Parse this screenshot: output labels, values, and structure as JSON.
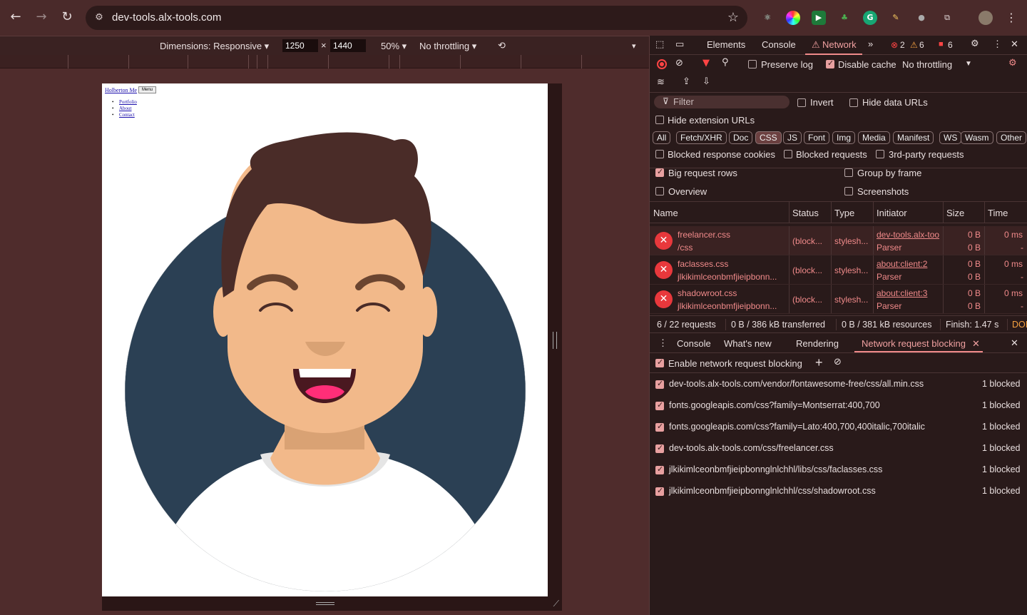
{
  "browser": {
    "url": "dev-tools.alx-tools.com",
    "back_icon": "←",
    "forward_icon": "→",
    "reload_icon": "↻",
    "site_info_icon": "⚙",
    "star_icon": "☆",
    "menu_icon": "⋮"
  },
  "device_toolbar": {
    "dimensions_label": "Dimensions: Responsive ▾",
    "width": "1250",
    "times": "×",
    "height": "1440",
    "zoom": "50% ▾",
    "throttling": "No throttling ▾",
    "more_icon": "▾"
  },
  "site": {
    "brand": "Holberton Me",
    "menu_button": "Menu",
    "nav": [
      "Portfolio",
      "About",
      "Contact"
    ]
  },
  "devtools": {
    "tabs": [
      "Elements",
      "Console",
      "Network"
    ],
    "network_warning_icon": "⚠",
    "active_tab": "Network",
    "more_tabs": "»",
    "errors_count": "2",
    "warnings_count": "6",
    "issues_count": "6",
    "toolbar": {
      "preserve_log": "Preserve log",
      "disable_cache": "Disable cache",
      "throttling": "No throttling"
    },
    "filter": {
      "placeholder": "Filter",
      "invert": "Invert",
      "hide_data_urls": "Hide data URLs",
      "hide_extension_urls": "Hide extension URLs"
    },
    "type_filters": [
      "All",
      "Fetch/XHR",
      "Doc",
      "CSS",
      "JS",
      "Font",
      "Img",
      "Media",
      "Manifest",
      "WS",
      "Wasm",
      "Other"
    ],
    "active_type": "CSS",
    "options": {
      "blocked_response_cookies": "Blocked response cookies",
      "blocked_requests": "Blocked requests",
      "third_party": "3rd-party requests",
      "big_request_rows": "Big request rows",
      "group_by_frame": "Group by frame",
      "overview": "Overview",
      "screenshots": "Screenshots"
    },
    "table": {
      "headers": [
        "Name",
        "Status",
        "Type",
        "Initiator",
        "Size",
        "Time"
      ],
      "rows": [
        {
          "name": "freelancer.css",
          "path": "/css",
          "status": "(block...",
          "type": "stylesh...",
          "initiator": "dev-tools.alx-too",
          "initiator_sub": "Parser",
          "size1": "0 B",
          "size2": "0 B",
          "time1": "0 ms",
          "time2": "-"
        },
        {
          "name": "faclasses.css",
          "path": "jlkikimlceonbmfjieipbonn...",
          "status": "(block...",
          "type": "stylesh...",
          "initiator": "about:client:2",
          "initiator_sub": "Parser",
          "size1": "0 B",
          "size2": "0 B",
          "time1": "0 ms",
          "time2": "-"
        },
        {
          "name": "shadowroot.css",
          "path": "jlkikimlceonbmfjieipbonn...",
          "status": "(block...",
          "type": "stylesh...",
          "initiator": "about:client:3",
          "initiator_sub": "Parser",
          "size1": "0 B",
          "size2": "0 B",
          "time1": "0 ms",
          "time2": "-"
        }
      ]
    },
    "summary": {
      "requests": "6 / 22 requests",
      "transferred": "0 B / 386 kB transferred",
      "resources": "0 B / 381 kB resources",
      "finish": "Finish: 1.47 s",
      "dom": "DOI"
    },
    "drawer": {
      "tabs": [
        "Console",
        "What's new",
        "Rendering",
        "Network request blocking"
      ],
      "active": "Network request blocking",
      "enable_label": "Enable network request blocking",
      "patterns": [
        {
          "url": "dev-tools.alx-tools.com/vendor/fontawesome-free/css/all.min.css",
          "count": "1 blocked"
        },
        {
          "url": "fonts.googleapis.com/css?family=Montserrat:400,700",
          "count": "1 blocked"
        },
        {
          "url": "fonts.googleapis.com/css?family=Lato:400,700,400italic,700italic",
          "count": "1 blocked"
        },
        {
          "url": "dev-tools.alx-tools.com/css/freelancer.css",
          "count": "1 blocked"
        },
        {
          "url": "jlkikimlceonbmfjieipbonnglnlchhl/libs/css/faclasses.css",
          "count": "1 blocked"
        },
        {
          "url": "jlkikimlceonbmfjieipbonnglnlchhl/css/shadowroot.css",
          "count": "1 blocked"
        }
      ]
    }
  },
  "colors": {
    "accent": "#f08a8a",
    "error": "#e8383c",
    "avatar_bg": "#2b4054",
    "skin": "#f2b98a",
    "hair": "#4a2c28"
  }
}
